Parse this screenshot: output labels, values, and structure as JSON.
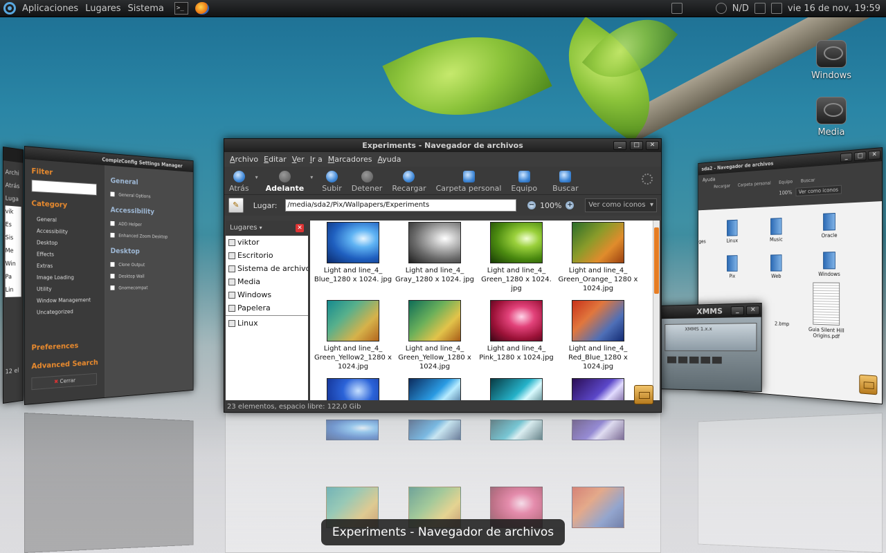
{
  "panel": {
    "menus": [
      "Aplicaciones",
      "Lugares",
      "Sistema"
    ],
    "network_status": "N/D",
    "clock": "vie 16 de nov, 19:59"
  },
  "desktop": {
    "icons": [
      {
        "label": "Windows",
        "icon": "drive-icon"
      },
      {
        "label": "Media",
        "icon": "drive-icon"
      }
    ]
  },
  "ccsm": {
    "title": "CompizConfig Settings Manager",
    "filter_label": "Filter",
    "category_label": "Category",
    "categories": [
      "General",
      "Accessibility",
      "Desktop",
      "Effects",
      "Extras",
      "Image Loading",
      "Utility",
      "Window Management",
      "Uncategorized"
    ],
    "sections": [
      {
        "title": "General",
        "options": [
          "General Options"
        ]
      },
      {
        "title": "Accessibility",
        "options": [
          "ADD Helper",
          "Enhanced Zoom Desktop"
        ]
      },
      {
        "title": "Desktop",
        "options": [
          "Clone Output",
          "Desktop Wall",
          "Gnomecompat"
        ]
      }
    ],
    "preferences": "Preferences",
    "advanced_search": "Advanced Search",
    "close": "Cerrar",
    "left_fragment": [
      "Archi",
      "Atrás",
      "Luga",
      "vik",
      "Es",
      "Sis",
      "Me",
      "Win",
      "Pa",
      "Lin",
      "12 el"
    ]
  },
  "main": {
    "title": "Experiments - Navegador de archivos",
    "menu": [
      "Archivo",
      "Editar",
      "Ver",
      "Ir a",
      "Marcadores",
      "Ayuda"
    ],
    "toolbar": {
      "back": "Atrás",
      "forward": "Adelante",
      "up": "Subir",
      "stop": "Detener",
      "reload": "Recargar",
      "home": "Carpeta personal",
      "computer": "Equipo",
      "search": "Buscar"
    },
    "location": {
      "label": "Lugar:",
      "path": "/media/sda2/Pix/Wallpapers/Experiments",
      "zoom": "100%",
      "view": "Ver como iconos"
    },
    "sidebar": {
      "header": "Lugares",
      "places": [
        "viktor",
        "Escritorio",
        "Sistema de archivos",
        "Media",
        "Windows",
        "Papelera"
      ],
      "bookmarks": [
        "Linux"
      ]
    },
    "files": [
      {
        "name": "Light and line_4_ Blue_1280 x 1024. jpg",
        "thumb": "t-blue"
      },
      {
        "name": "Light and line_4_ Gray_1280 x 1024. jpg",
        "thumb": "t-gray"
      },
      {
        "name": "Light and line_4_ Green_1280 x 1024. jpg",
        "thumb": "t-green"
      },
      {
        "name": "Light and line_4_ Green_Orange_ 1280 x 1024.jpg",
        "thumb": "t-greenorange"
      },
      {
        "name": "Light and line_4_ Green_Yellow2_1280 x 1024.jpg",
        "thumb": "t-gy2"
      },
      {
        "name": "Light and line_4_ Green_Yellow_1280 x 1024.jpg",
        "thumb": "t-gy"
      },
      {
        "name": "Light and line_4_ Pink_1280 x 1024.jpg",
        "thumb": "t-pink"
      },
      {
        "name": "Light and line_4_ Red_Blue_1280 x 1024.jpg",
        "thumb": "t-redblue"
      },
      {
        "name": "",
        "thumb": "t-deepblue"
      },
      {
        "name": "",
        "thumb": "t-cyan"
      },
      {
        "name": "",
        "thumb": "t-teal"
      },
      {
        "name": "",
        "thumb": "t-purple"
      }
    ],
    "status": "23 elementos, espacio libre: 122,0 Gib"
  },
  "right_window": {
    "title": "sda2 - Navegador de archivos",
    "menu": [
      "Ayuda"
    ],
    "toolbar": [
      "Recargar",
      "Carpeta personal",
      "Equipo",
      "Buscar"
    ],
    "zoom": "100%",
    "view": "Ver como iconos",
    "items": [
      "ages",
      "Linux",
      "Music",
      "Oracle",
      "Pix",
      "Web",
      "Windows",
      "2.bmp",
      "Guia Silent Hill Origins.pdf"
    ]
  },
  "xmms": {
    "title": "XMMS",
    "display": "XMMS 1.x.x"
  },
  "switcher": {
    "label": "Experiments - Navegador de archivos"
  }
}
